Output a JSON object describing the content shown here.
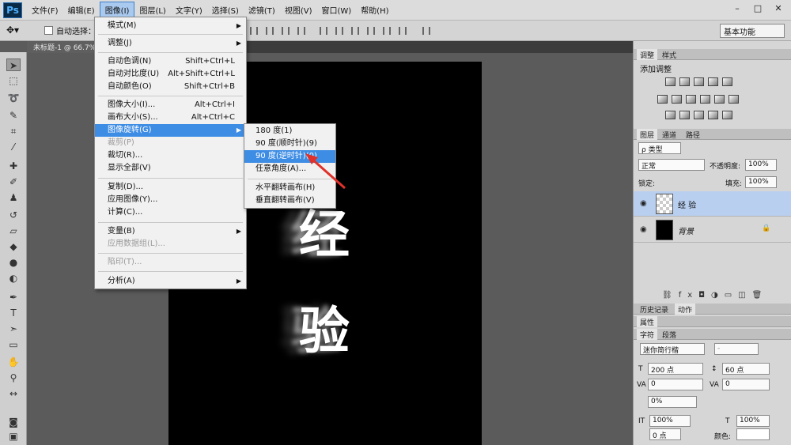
{
  "app": {
    "logo": "Ps"
  },
  "menubar": [
    "文件(F)",
    "编辑(E)",
    "图像(I)",
    "图层(L)",
    "文字(Y)",
    "选择(S)",
    "滤镜(T)",
    "视图(V)",
    "窗口(W)",
    "帮助(H)"
  ],
  "window_controls": [
    "–",
    "□",
    "✕"
  ],
  "options": {
    "auto_select": "自动选择：",
    "workspace": "基本功能"
  },
  "doc_tab": "未标题-1 @ 66.7%",
  "image_menu": {
    "mode": "模式(M)",
    "adjust": "调整(J)",
    "auto_tone": "自动色调(N)",
    "auto_tone_sc": "Shift+Ctrl+L",
    "auto_contrast": "自动对比度(U)",
    "auto_contrast_sc": "Alt+Shift+Ctrl+L",
    "auto_color": "自动颜色(O)",
    "auto_color_sc": "Shift+Ctrl+B",
    "image_size": "图像大小(I)...",
    "image_size_sc": "Alt+Ctrl+I",
    "canvas_size": "画布大小(S)...",
    "canvas_size_sc": "Alt+Ctrl+C",
    "rotation": "图像旋转(G)",
    "crop": "裁剪(P)",
    "trim": "裁切(R)...",
    "reveal_all": "显示全部(V)",
    "duplicate": "复制(D)...",
    "apply_image": "应用图像(Y)...",
    "calculations": "计算(C)...",
    "variables": "变量(B)",
    "apply_dataset": "应用数据组(L)...",
    "trap": "陷印(T)...",
    "analysis": "分析(A)"
  },
  "rotation_menu": [
    "180 度(1)",
    "90 度(顺时针)(9)",
    "90 度(逆时针)(0)",
    "任意角度(A)...",
    "水平翻转画布(H)",
    "垂直翻转画布(V)"
  ],
  "panels": {
    "adjust_tabs": [
      "调整",
      "样式"
    ],
    "add_adjustment": "添加调整",
    "layer_tabs": [
      "图层",
      "通道",
      "路径"
    ],
    "kind": "ρ 类型",
    "blend_mode": "正常",
    "opacity_label": "不透明度:",
    "opacity": "100%",
    "lock_label": "锁定:",
    "fill_label": "填充:",
    "fill": "100%",
    "layers": [
      {
        "name": "经 验"
      },
      {
        "name": "背景"
      }
    ],
    "history_tabs": [
      "历史记录",
      "动作"
    ],
    "properties_tab": "属性",
    "char_tabs": [
      "字符",
      "段落"
    ],
    "font_family": "迷你简行楷",
    "font_style": "-",
    "font_size": "200 点",
    "leading": "60 点",
    "kerning": "0",
    "tracking": "0",
    "scale_pct": "0%",
    "vscale": "100%",
    "hscale": "100%",
    "baseline": "0 点",
    "color_label": "颜色:"
  }
}
